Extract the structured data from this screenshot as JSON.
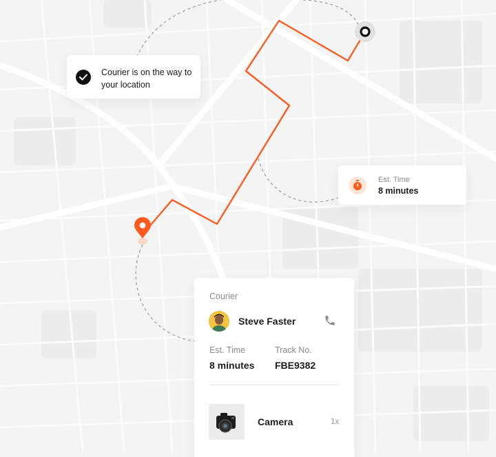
{
  "colors": {
    "accent": "#ff5a1f",
    "map_background": "#f4f4f4",
    "dark": "#121212"
  },
  "status_notice": {
    "icon": "check-circle-icon",
    "text": "Courier is on the way to your location"
  },
  "eta_bubble": {
    "icon": "stopwatch-icon",
    "label": "Est. Time",
    "value": "8 minutes"
  },
  "courier_panel": {
    "section_title": "Courier",
    "courier_name": "Steve Faster",
    "call_icon": "phone-icon",
    "est_time_label": "Est. Time",
    "est_time_value": "8 minutes",
    "track_label": "Track No.",
    "track_value": "FBE9382",
    "item": {
      "image_icon": "camera-icon",
      "name": "Camera",
      "quantity": "1x"
    }
  },
  "map": {
    "origin_icon": "location-pin-icon",
    "destination_icon": "destination-ring-icon"
  }
}
